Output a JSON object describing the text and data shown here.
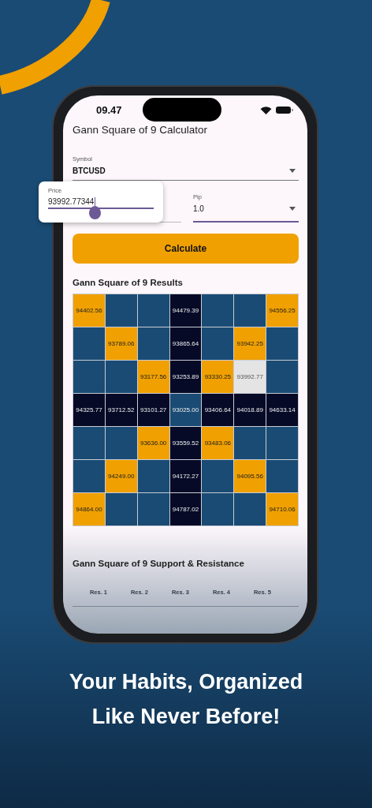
{
  "status_bar": {
    "time": "09.47"
  },
  "title": "Gann Square of 9 Calculator",
  "symbol": {
    "label": "Symbol",
    "value": "BTCUSD"
  },
  "price": {
    "label": "Price",
    "value": "93992.77344"
  },
  "pip": {
    "label": "Pip",
    "value": "1.0"
  },
  "calculate_button": "Calculate",
  "results": {
    "title": "Gann Square of 9 Results",
    "rows": [
      [
        {
          "kind": "diagonal",
          "text": "94402.56"
        },
        {
          "kind": "empty"
        },
        {
          "kind": "empty"
        },
        {
          "kind": "axis",
          "text": "94479.39"
        },
        {
          "kind": "empty"
        },
        {
          "kind": "empty"
        },
        {
          "kind": "diagonal",
          "text": "94556.25"
        }
      ],
      [
        {
          "kind": "empty"
        },
        {
          "kind": "diagonal",
          "text": "93789.06"
        },
        {
          "kind": "empty"
        },
        {
          "kind": "axis",
          "text": "93865.64"
        },
        {
          "kind": "empty"
        },
        {
          "kind": "diagonal",
          "text": "93942.25"
        },
        {
          "kind": "empty"
        }
      ],
      [
        {
          "kind": "empty"
        },
        {
          "kind": "empty"
        },
        {
          "kind": "diagonal",
          "text": "93177.56"
        },
        {
          "kind": "axis",
          "text": "93253.89"
        },
        {
          "kind": "diagonal",
          "text": "93330.25"
        },
        {
          "kind": "current",
          "text": "93992.77"
        },
        {
          "kind": "empty"
        }
      ],
      [
        {
          "kind": "axis",
          "text": "94325.77"
        },
        {
          "kind": "axis",
          "text": "93712.52"
        },
        {
          "kind": "axis",
          "text": "93101.27"
        },
        {
          "kind": "center",
          "text": "93025.00"
        },
        {
          "kind": "axis",
          "text": "93406.64"
        },
        {
          "kind": "axis",
          "text": "94018.89"
        },
        {
          "kind": "axis",
          "text": "94633.14"
        }
      ],
      [
        {
          "kind": "empty"
        },
        {
          "kind": "empty"
        },
        {
          "kind": "diagonal",
          "text": "93636.00"
        },
        {
          "kind": "axis",
          "text": "93559.52"
        },
        {
          "kind": "diagonal",
          "text": "93483.06"
        },
        {
          "kind": "empty"
        },
        {
          "kind": "empty"
        }
      ],
      [
        {
          "kind": "empty"
        },
        {
          "kind": "diagonal",
          "text": "94249.00"
        },
        {
          "kind": "empty"
        },
        {
          "kind": "axis",
          "text": "94172.27"
        },
        {
          "kind": "empty"
        },
        {
          "kind": "diagonal",
          "text": "94095.56"
        },
        {
          "kind": "empty"
        }
      ],
      [
        {
          "kind": "diagonal",
          "text": "94864.00"
        },
        {
          "kind": "empty"
        },
        {
          "kind": "empty"
        },
        {
          "kind": "axis",
          "text": "94787.02"
        },
        {
          "kind": "empty"
        },
        {
          "kind": "empty"
        },
        {
          "kind": "diagonal",
          "text": "94710.06"
        }
      ]
    ]
  },
  "support_resistance": {
    "title": "Gann Square of 9 Support & Resistance",
    "columns": [
      "Res. 1",
      "Res. 2",
      "Res. 3",
      "Res. 4",
      "Res. 5"
    ]
  },
  "tagline": [
    "Your Habits, Organized",
    "Like Never Before!"
  ]
}
